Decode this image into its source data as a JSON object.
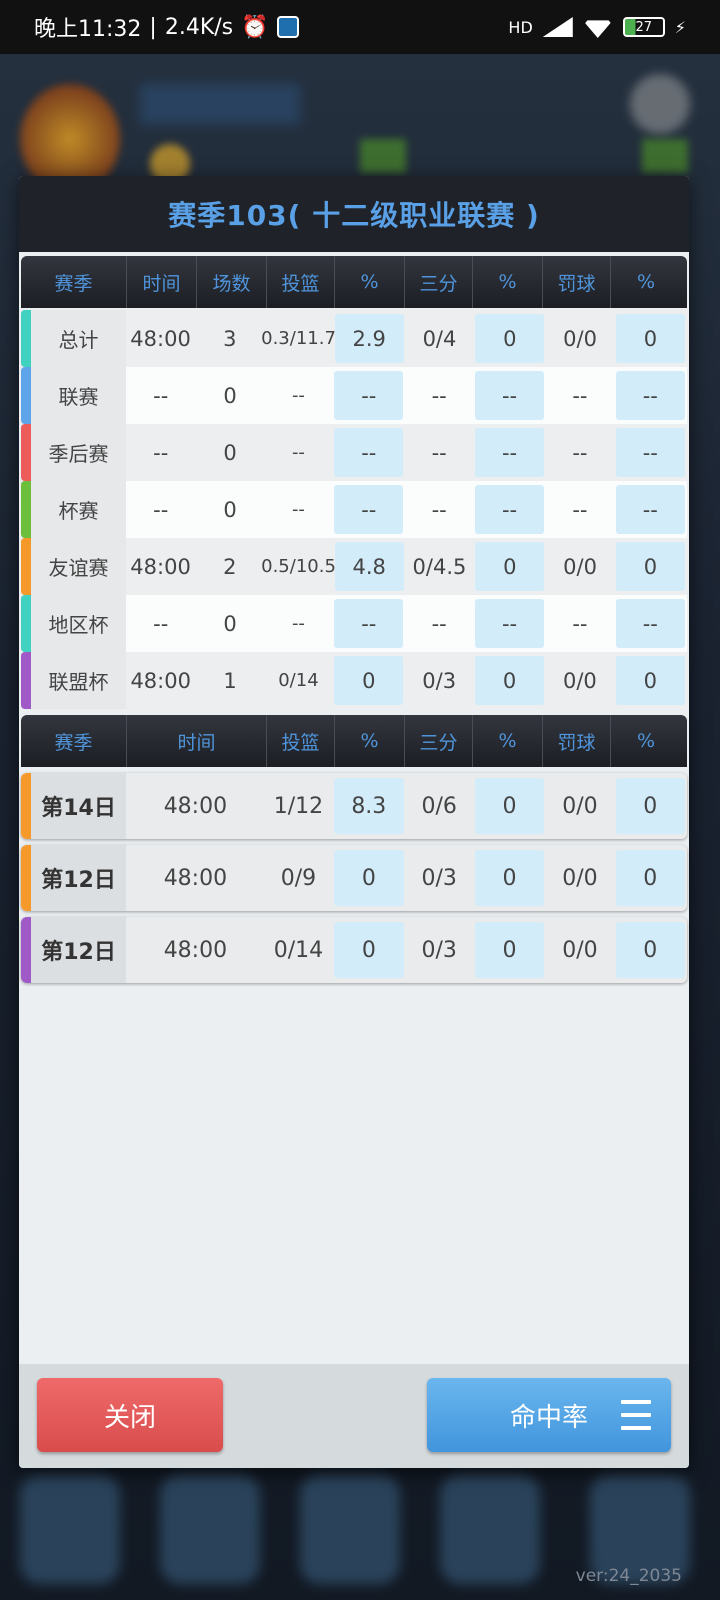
{
  "status_bar": {
    "time": "晚上11:32",
    "speed": "2.4K/s",
    "battery": "27",
    "network": "HD"
  },
  "version": "ver:24_2035",
  "dialog": {
    "title": "赛季103( 十二级职业联赛 )",
    "summary_headers": [
      "赛季",
      "时间",
      "场数",
      "投篮",
      "%",
      "三分",
      "%",
      "罚球",
      "%"
    ],
    "summary_rows": [
      {
        "name": "总计",
        "color": "#3fd2c0",
        "time": "48:00",
        "games": "3",
        "fg": "0.3/11.7",
        "fg_pct": "2.9",
        "three": "0/4",
        "three_pct": "0",
        "ft": "0/0",
        "ft_pct": "0"
      },
      {
        "name": "联赛",
        "color": "#5ea4ea",
        "time": "--",
        "games": "0",
        "fg": "--",
        "fg_pct": "--",
        "three": "--",
        "three_pct": "--",
        "ft": "--",
        "ft_pct": "--"
      },
      {
        "name": "季后赛",
        "color": "#ee5b5b",
        "time": "--",
        "games": "0",
        "fg": "--",
        "fg_pct": "--",
        "three": "--",
        "three_pct": "--",
        "ft": "--",
        "ft_pct": "--"
      },
      {
        "name": "杯赛",
        "color": "#6cbf3a",
        "time": "--",
        "games": "0",
        "fg": "--",
        "fg_pct": "--",
        "three": "--",
        "three_pct": "--",
        "ft": "--",
        "ft_pct": "--"
      },
      {
        "name": "友谊赛",
        "color": "#f59a2a",
        "time": "48:00",
        "games": "2",
        "fg": "0.5/10.5",
        "fg_pct": "4.8",
        "three": "0/4.5",
        "three_pct": "0",
        "ft": "0/0",
        "ft_pct": "0"
      },
      {
        "name": "地区杯",
        "color": "#3fd2c0",
        "time": "--",
        "games": "0",
        "fg": "--",
        "fg_pct": "--",
        "three": "--",
        "three_pct": "--",
        "ft": "--",
        "ft_pct": "--"
      },
      {
        "name": "联盟杯",
        "color": "#a05ac8",
        "time": "48:00",
        "games": "1",
        "fg": "0/14",
        "fg_pct": "0",
        "three": "0/3",
        "three_pct": "0",
        "ft": "0/0",
        "ft_pct": "0"
      }
    ],
    "game_headers": [
      "赛季",
      "时间",
      "投篮",
      "%",
      "三分",
      "%",
      "罚球",
      "%"
    ],
    "games": [
      {
        "name": "第14日",
        "color": "#f59a2a",
        "time": "48:00",
        "fg": "1/12",
        "fg_pct": "8.3",
        "three": "0/6",
        "three_pct": "0",
        "ft": "0/0",
        "ft_pct": "0"
      },
      {
        "name": "第12日",
        "color": "#f59a2a",
        "time": "48:00",
        "fg": "0/9",
        "fg_pct": "0",
        "three": "0/3",
        "three_pct": "0",
        "ft": "0/0",
        "ft_pct": "0"
      },
      {
        "name": "第12日",
        "color": "#a05ac8",
        "time": "48:00",
        "fg": "0/14",
        "fg_pct": "0",
        "three": "0/3",
        "three_pct": "0",
        "ft": "0/0",
        "ft_pct": "0"
      }
    ],
    "close_label": "关闭",
    "rate_label": "命中率"
  }
}
